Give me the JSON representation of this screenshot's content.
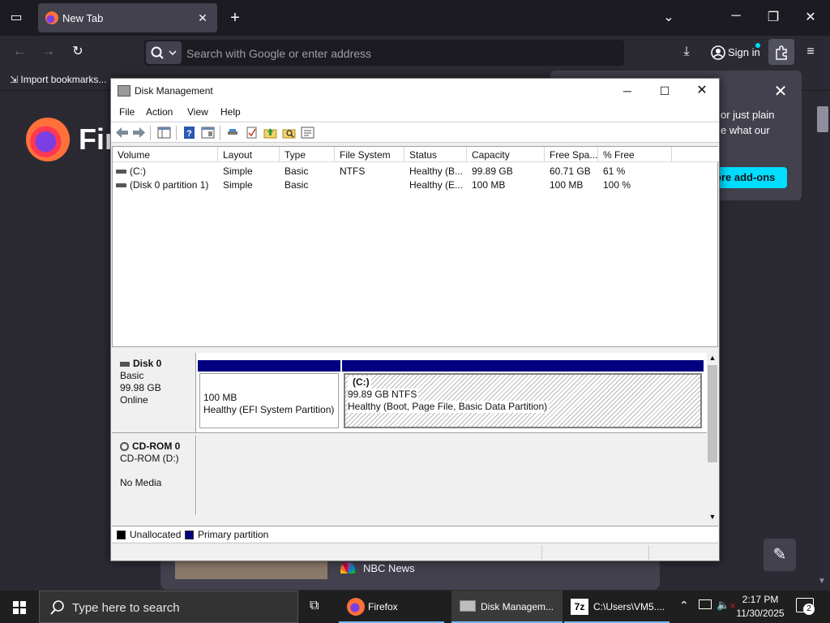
{
  "browser": {
    "tab_title": "New Tab",
    "tab_close": "✕",
    "new_tab": "+",
    "search_placeholder": "Search with Google or enter address",
    "sign_in": "Sign in",
    "import_bookmarks": "Import bookmarks...",
    "brand_partial": "Fir",
    "panel_text_1": "or just plain",
    "panel_text_2": "e what our",
    "panel_button": "ore add-ons",
    "news_source": "NBC News"
  },
  "window": {
    "title": "Disk Management",
    "menu": [
      "File",
      "Action",
      "View",
      "Help"
    ]
  },
  "volume_list": {
    "columns": [
      "Volume",
      "Layout",
      "Type",
      "File System",
      "Status",
      "Capacity",
      "Free Spa...",
      "% Free"
    ],
    "rows": [
      [
        "(C:)",
        "Simple",
        "Basic",
        "NTFS",
        "Healthy (B...",
        "99.89 GB",
        "60.71 GB",
        "61 %"
      ],
      [
        "(Disk 0 partition 1)",
        "Simple",
        "Basic",
        "",
        "Healthy (E...",
        "100 MB",
        "100 MB",
        "100 %"
      ]
    ]
  },
  "disks": [
    {
      "name": "Disk 0",
      "type": "Basic",
      "size": "99.98 GB",
      "status": "Online",
      "partitions": [
        {
          "size": "100 MB",
          "status": "Healthy (EFI System Partition)"
        },
        {
          "label": "(C:)",
          "size": "99.89 GB NTFS",
          "status": "Healthy (Boot, Page File, Basic Data Partition)"
        }
      ]
    },
    {
      "name": "CD-ROM 0",
      "type": "CD-ROM (D:)",
      "media": "No Media"
    }
  ],
  "legend": {
    "unallocated": "Unallocated",
    "primary": "Primary partition",
    "unallocated_color": "#000000",
    "primary_color": "#000080"
  },
  "taskbar": {
    "search_placeholder": "Type here to search",
    "apps": [
      "Firefox",
      "Disk Managem...",
      "C:\\Users\\VM5...."
    ],
    "time": "2:17 PM",
    "date": "11/30/2025",
    "notification_count": "2"
  }
}
